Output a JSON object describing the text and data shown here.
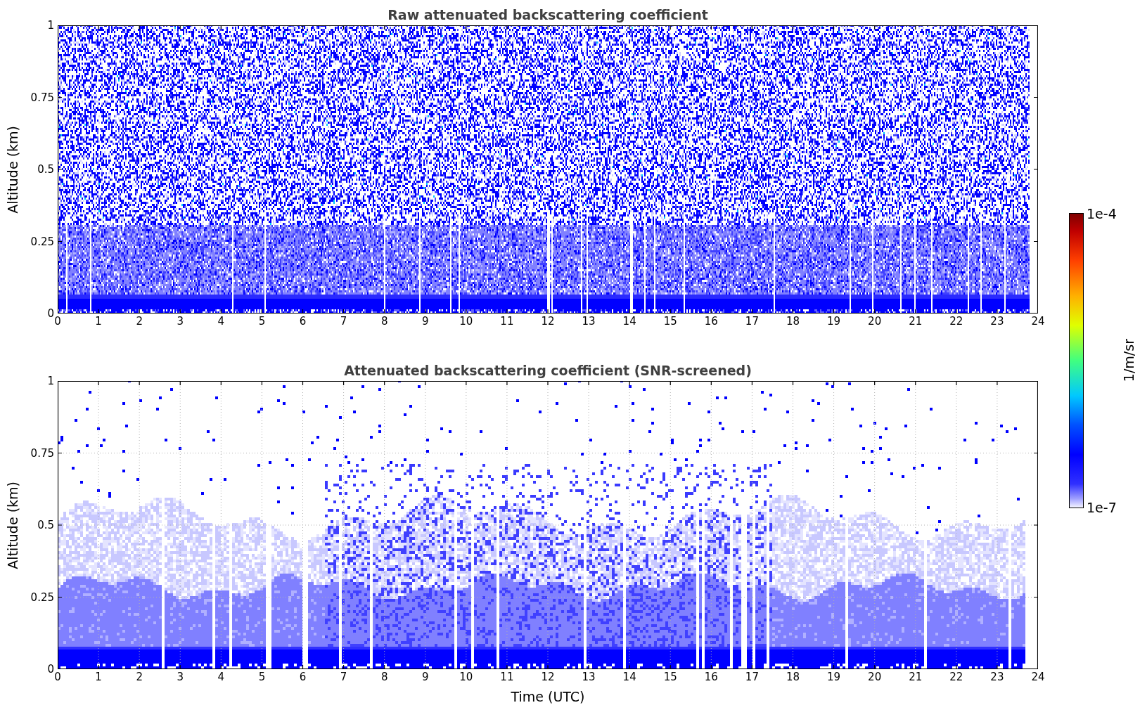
{
  "figure": {
    "panels": [
      {
        "kind": "raw",
        "title": "Raw attenuated backscattering coefficient",
        "ylabel": "Altitude (km)",
        "grid": false,
        "yticks": [
          "1",
          "0.75",
          "0.5",
          "0.25",
          "0"
        ],
        "xticks": [
          "0",
          "1",
          "2",
          "3",
          "4",
          "5",
          "6",
          "7",
          "8",
          "9",
          "10",
          "11",
          "12",
          "13",
          "14",
          "15",
          "16",
          "17",
          "18",
          "19",
          "20",
          "21",
          "22",
          "23",
          "24"
        ]
      },
      {
        "kind": "screened",
        "title": "Attenuated backscattering coefficient (SNR-screened)",
        "ylabel": "Altitude (km)",
        "grid": true,
        "yticks": [
          "1",
          "0.75",
          "0.5",
          "0.25",
          "0"
        ],
        "xticks": [
          "0",
          "1",
          "2",
          "3",
          "4",
          "5",
          "6",
          "7",
          "8",
          "9",
          "10",
          "11",
          "12",
          "13",
          "14",
          "15",
          "16",
          "17",
          "18",
          "19",
          "20",
          "21",
          "22",
          "23",
          "24"
        ]
      }
    ],
    "xlabel": "Time (UTC)",
    "colorbar": {
      "label": "1/m/sr",
      "max": "1e-4",
      "min": "1e-7"
    }
  }
}
